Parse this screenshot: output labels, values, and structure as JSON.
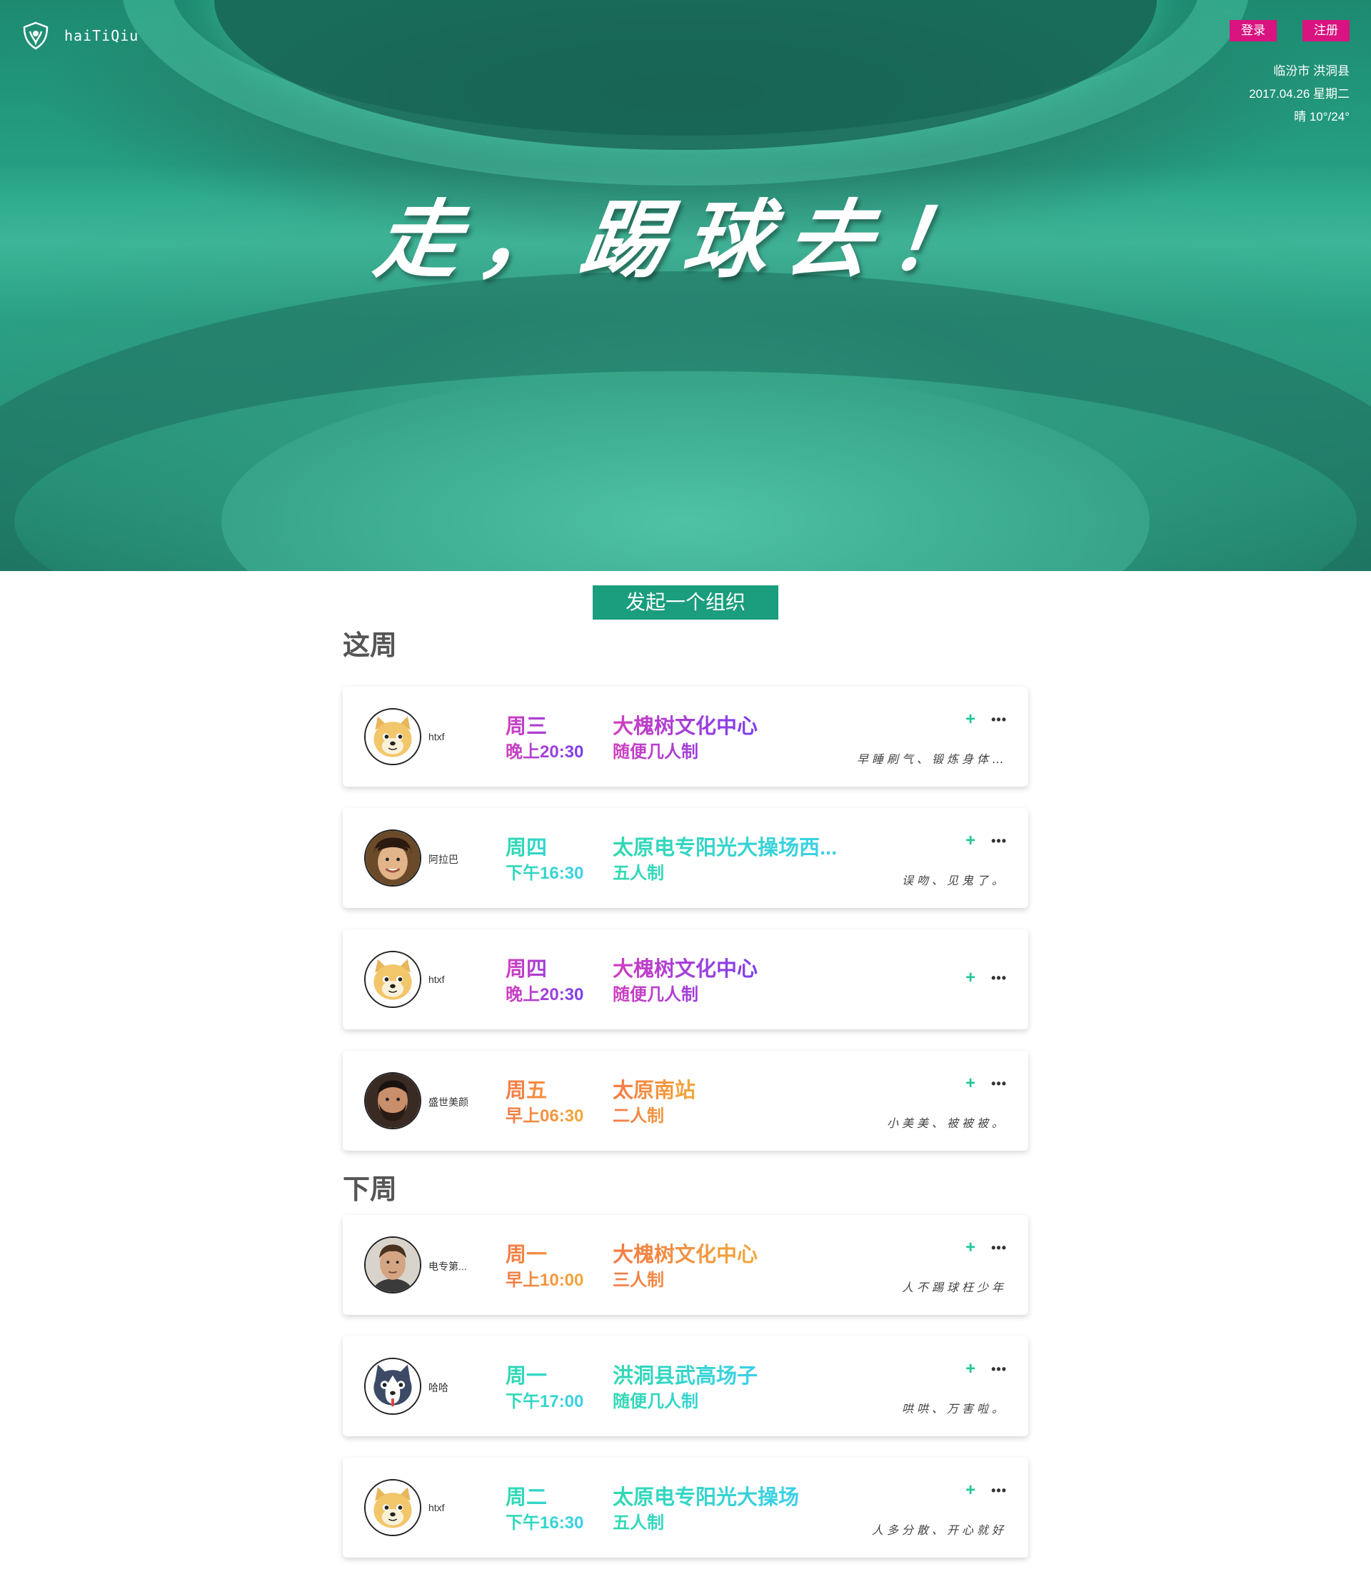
{
  "brand": {
    "name": "haiTiQiu",
    "logo_icon": "football-shield-icon"
  },
  "auth": {
    "login_label": "登录",
    "register_label": "注册"
  },
  "info": {
    "location": "临汾市 洪洞县",
    "date": "2017.04.26 星期二",
    "weather": "晴 10°/24°"
  },
  "hero": {
    "slogan": "走，踢球去！"
  },
  "cta": {
    "label": "发起一个组织"
  },
  "this_week": {
    "title": "这周",
    "cards": [
      {
        "user": "htxf",
        "avatar_icon": "doge-avatar-icon",
        "day": "周三",
        "time": "晚上20:30",
        "place": "大槐树文化中心",
        "mode": "随便几人制",
        "note": "早睡刷气、锻炼身体…",
        "color": "purple"
      },
      {
        "user": "阿拉巴",
        "avatar_icon": "boy-avatar-icon",
        "day": "周四",
        "time": "下午16:30",
        "place": "太原电专阳光大操场西...",
        "mode": "五人制",
        "note": "误吻、见鬼了。",
        "color": "teal"
      },
      {
        "user": "htxf",
        "avatar_icon": "doge-avatar-icon",
        "day": "周四",
        "time": "晚上20:30",
        "place": "大槐树文化中心",
        "mode": "随便几人制",
        "note": "",
        "color": "purple"
      },
      {
        "user": "盛世美颜",
        "avatar_icon": "bearded-man-avatar-icon",
        "day": "周五",
        "time": "早上06:30",
        "place": "太原南站",
        "mode": "二人制",
        "note": "小美美、被被被。",
        "color": "orange"
      }
    ]
  },
  "next_week": {
    "title": "下周",
    "cards": [
      {
        "user": "电专第...",
        "avatar_icon": "man-avatar-icon",
        "day": "周一",
        "time": "早上10:00",
        "place": "大槐树文化中心",
        "mode": "三人制",
        "note": "人不踢球枉少年",
        "color": "orange"
      },
      {
        "user": "哈哈",
        "avatar_icon": "husky-avatar-icon",
        "day": "周一",
        "time": "下午17:00",
        "place": "洪洞县武高场子",
        "mode": "随便几人制",
        "note": "哄哄、万害啦。",
        "color": "teal"
      },
      {
        "user": "htxf",
        "avatar_icon": "doge-avatar-icon",
        "day": "周二",
        "time": "下午16:30",
        "place": "太原电专阳光大操场",
        "mode": "五人制",
        "note": "人多分散、开心就好",
        "color": "teal"
      }
    ]
  },
  "card_actions": {
    "add_glyph": "+",
    "more_glyph": "•••"
  }
}
